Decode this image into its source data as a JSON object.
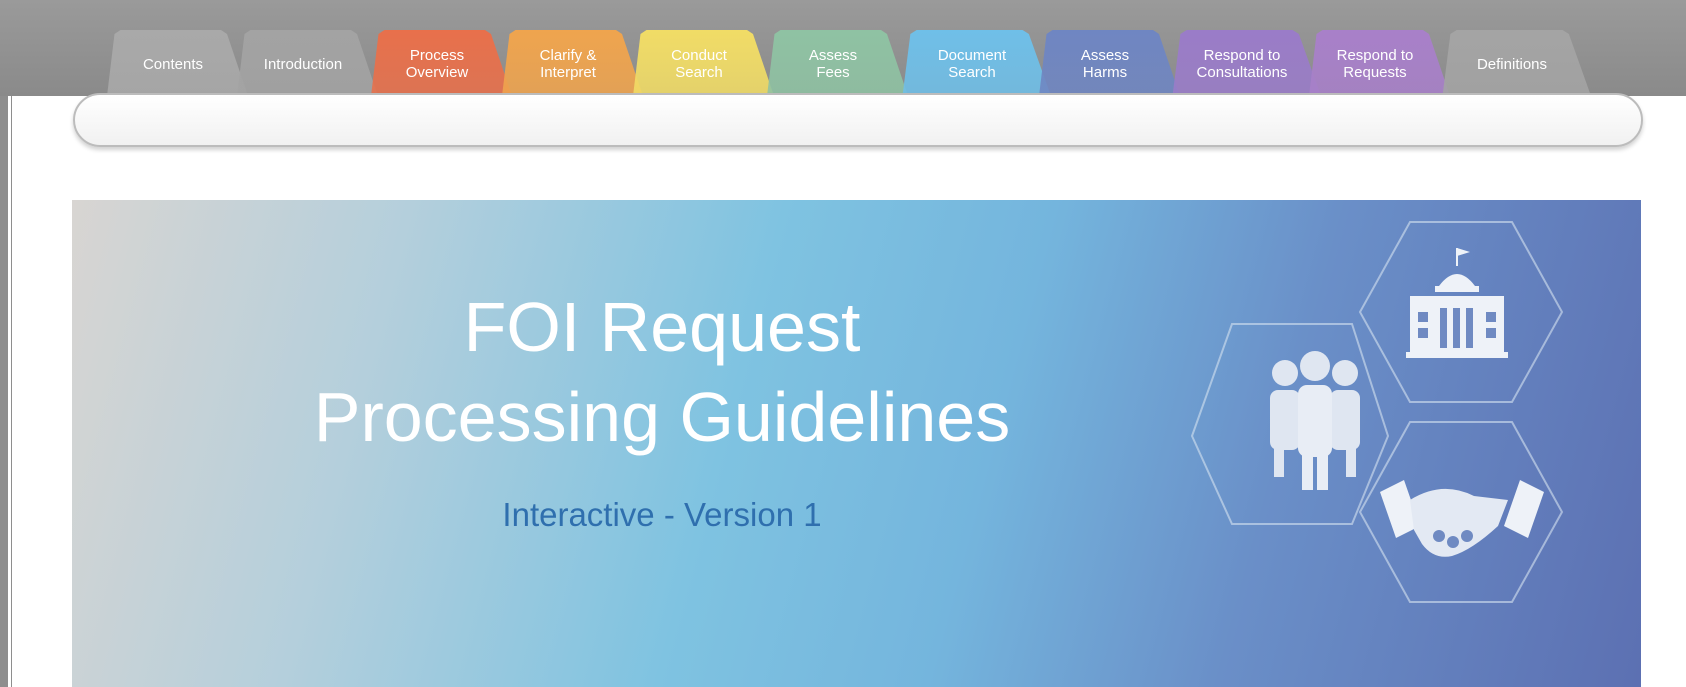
{
  "tabs": [
    {
      "label": "Contents",
      "color": "#a9a9a9"
    },
    {
      "label": "Introduction",
      "color": "#a3a3a3"
    },
    {
      "label": "Process\nOverview",
      "color": "#e8704b"
    },
    {
      "label": "Clarify &\nInterpret",
      "color": "#efa44e"
    },
    {
      "label": "Conduct\nSearch",
      "color": "#f1dc66"
    },
    {
      "label": "Assess\nFees",
      "color": "#8fc2a3"
    },
    {
      "label": "Document\nSearch",
      "color": "#6fbfe8"
    },
    {
      "label": "Assess\nHarms",
      "color": "#6f86c2"
    },
    {
      "label": "Respond to\nConsultations",
      "color": "#9a7cc8"
    },
    {
      "label": "Respond to\nRequests",
      "color": "#a880c9"
    },
    {
      "label": "Definitions",
      "color": "#a4a4a4"
    }
  ],
  "hero": {
    "title_line1": "FOI Request",
    "title_line2": "Processing Guidelines",
    "subtitle": "Interactive - Version 1"
  },
  "icons": [
    "people-icon",
    "government-building-icon",
    "handshake-icon"
  ]
}
